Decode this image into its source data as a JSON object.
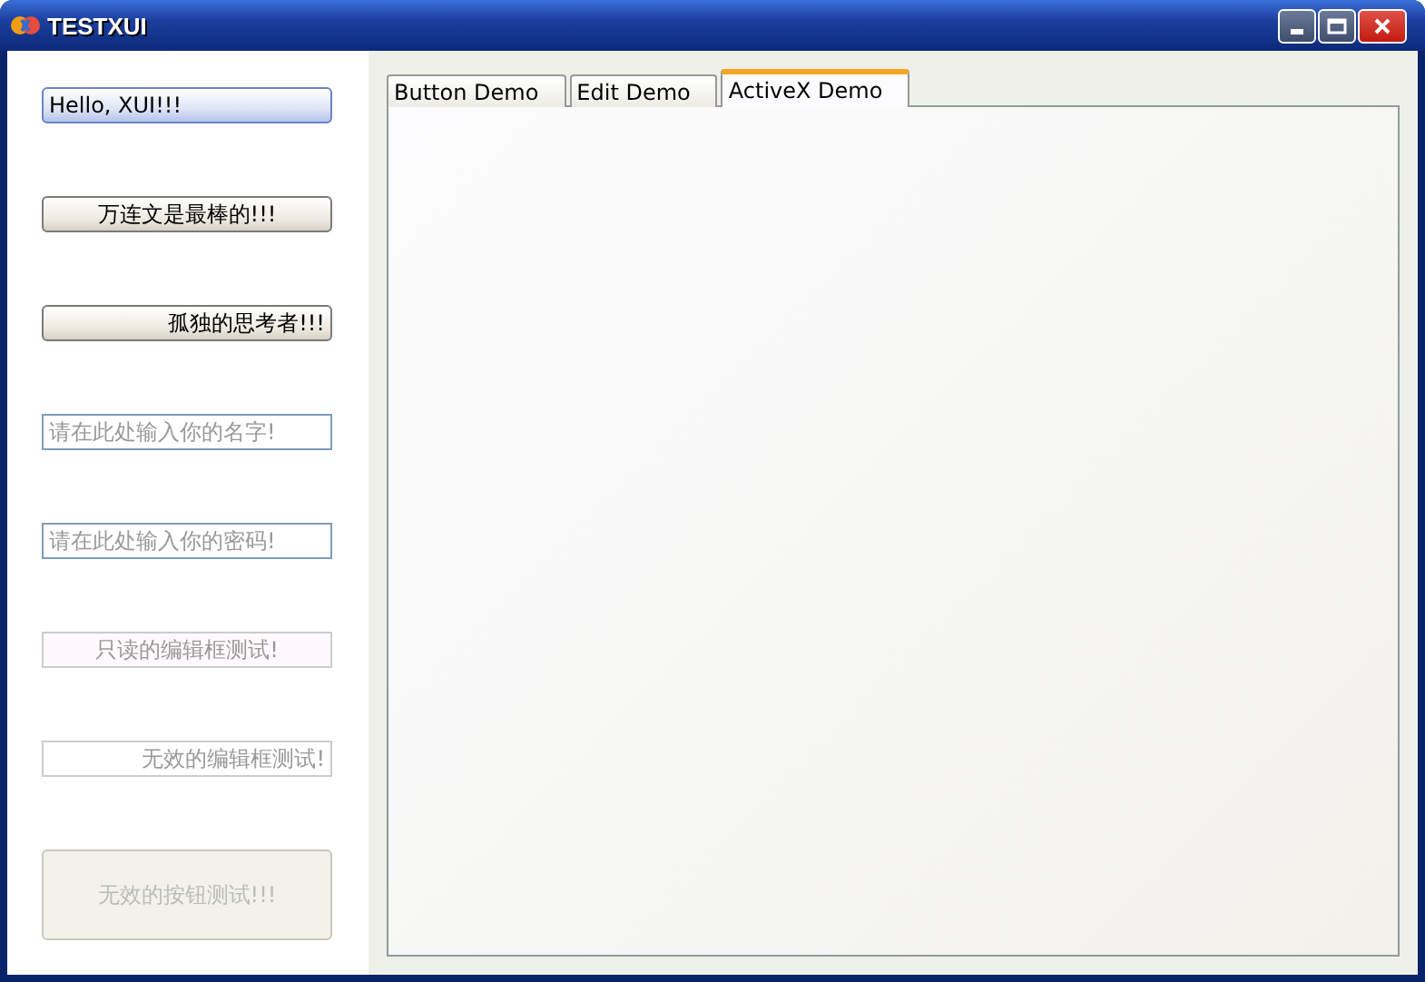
{
  "window": {
    "title": "TESTXUI"
  },
  "controls": [
    {
      "kind": "left-button",
      "label": "Hello, XUI!!!",
      "focused": true,
      "disabled": false
    },
    {
      "kind": "center-button",
      "label": "万连文是最棒的!!!",
      "focused": false,
      "disabled": false
    },
    {
      "kind": "right-button",
      "label": "孤独的思考者!!!",
      "focused": false,
      "disabled": false
    },
    {
      "kind": "left-field",
      "placeholder": "请在此处输入你的名字!",
      "readonly": false,
      "disabled": false
    },
    {
      "kind": "left-field",
      "placeholder": "请在此处输入你的密码!",
      "readonly": false,
      "disabled": false
    },
    {
      "kind": "center-field",
      "value": "只读的编辑框测试!",
      "readonly": true,
      "disabled": false
    },
    {
      "kind": "right-field",
      "value": "无效的编辑框测试!",
      "readonly": false,
      "disabled": true
    },
    {
      "kind": "big-button",
      "label": "无效的按钮测试!!!",
      "focused": false,
      "disabled": true
    }
  ],
  "tabs": [
    {
      "label": "Button Demo",
      "selected": false
    },
    {
      "label": "Edit Demo",
      "selected": false
    },
    {
      "label": "ActiveX Demo",
      "selected": true
    }
  ]
}
